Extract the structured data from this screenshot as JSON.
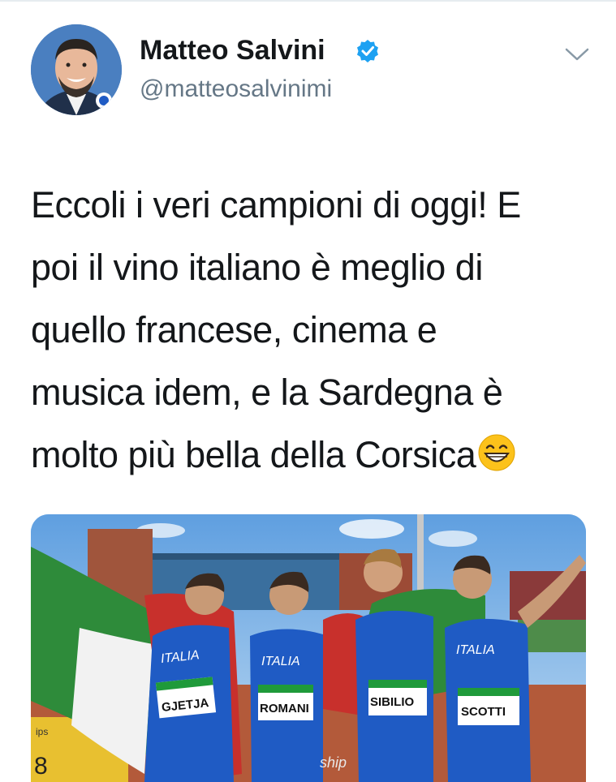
{
  "tweet": {
    "author_name": "Matteo Salvini",
    "handle": "@matteosalvinimi",
    "verified": true,
    "text_lines": [
      "Eccoli i veri campioni di oggi! E",
      "poi il vino italiano è meglio di",
      "quello francese, cinema e",
      "musica idem, e la Sardegna è",
      "molto più bella della Corsica"
    ],
    "emoji": "grinning-face-emoji",
    "menu_icon": "chevron-down-icon"
  },
  "photo": {
    "bibs": [
      "GJETJA",
      "ROMANI",
      "SIBILIO",
      "SCOTTI"
    ],
    "jersey_text": "ITALIA",
    "scoreboard_digit": "8",
    "scoreboard_text": "ips",
    "banner_text": "ship"
  },
  "colors": {
    "verified_blue": "#1da1f2",
    "text_dark": "#14171a",
    "text_gray": "#657786",
    "jersey_blue": "#1f5bc4",
    "flag_green": "#2e8b3a",
    "flag_red": "#c8302c"
  }
}
